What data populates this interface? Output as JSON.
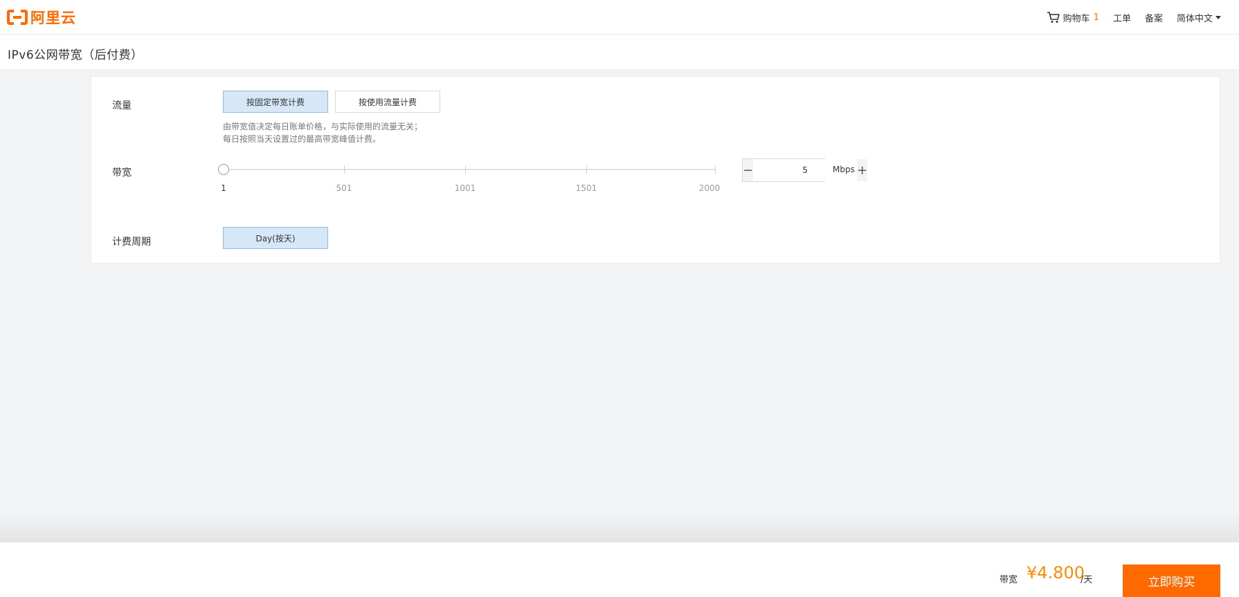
{
  "header": {
    "logo_text": "阿里云",
    "nav": {
      "cart_label": "购物车",
      "cart_count": "1",
      "ticket": "工单",
      "filing": "备案",
      "language": "简体中文"
    }
  },
  "page": {
    "title": "IPv6公网带宽（后付费）"
  },
  "form": {
    "traffic": {
      "label": "流量",
      "options": [
        "按固定带宽计费",
        "按使用流量计费"
      ],
      "selected": "按固定带宽计费",
      "hint_lines": [
        "由带宽值决定每日账单价格，与实际使用的流量无关；",
        "每日按照当天设置过的最高带宽峰值计费。"
      ]
    },
    "bandwidth": {
      "label": "带宽",
      "slider": {
        "min": 1,
        "max": 2000,
        "value": 5,
        "ticks": [
          "1",
          "501",
          "1001",
          "1501",
          "2000"
        ]
      },
      "stepper": {
        "minus": "−",
        "plus": "+",
        "value": "5"
      },
      "unit": "Mbps"
    },
    "billing_cycle": {
      "label": "计费周期",
      "options": [
        "Day(按天)"
      ],
      "selected": "Day(按天)"
    }
  },
  "footer": {
    "price_label": "带宽",
    "price": "¥4.800",
    "price_unit": "/天",
    "buy_button": "立即购买"
  },
  "colors": {
    "accent": "#ff6a00",
    "price": "#ff8a00",
    "selected_bg": "#d6e8f7",
    "selected_border": "#8cbbe6",
    "page_bg": "#f2f3f5"
  }
}
